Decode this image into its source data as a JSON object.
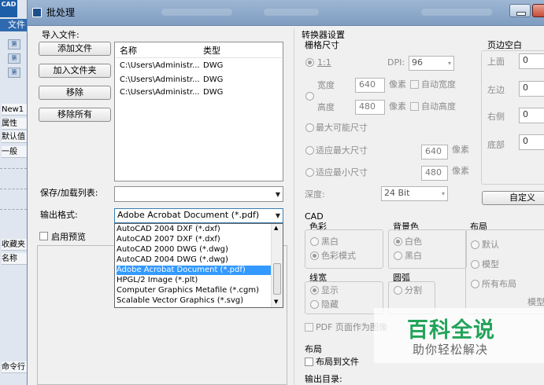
{
  "bg_app": {
    "logo": "CAD",
    "menu": "文件",
    "tool_labels": [
      "第",
      "第",
      "第"
    ],
    "tab": "New1",
    "panel_title": "属性",
    "default_label": "默认值",
    "tree_item": "一般",
    "fav_label": "收藏夹",
    "name_label": "名称",
    "cmd_label": "命令行"
  },
  "dialog": {
    "title": "批处理",
    "import_label": "导入文件:",
    "buttons": {
      "add_file": "添加文件",
      "add_folder": "加入文件夹",
      "remove": "移除",
      "remove_all": "移除所有",
      "custom": "自定义"
    },
    "file_list": {
      "columns": [
        "名称",
        "类型"
      ],
      "rows": [
        {
          "name": "C:\\Users\\Administr...",
          "type": "DWG"
        },
        {
          "name": "C:\\Users\\Administr...",
          "type": "DWG"
        },
        {
          "name": "C:\\Users\\Administr...",
          "type": "DWG"
        }
      ]
    },
    "save_list_label": "保存/加载列表:",
    "save_list_value": "",
    "output_format_label": "输出格式:",
    "output_format_value": "Adobe Acrobat Document (*.pdf)",
    "enable_preview_label": "启用预览",
    "format_options": [
      "AutoCAD 2004 DXF (*.dxf)",
      "AutoCAD 2007 DXF (*.dxf)",
      "AutoCAD 2000 DWG (*.dwg)",
      "AutoCAD 2004 DWG (*.dwg)",
      "Adobe Acrobat Document (*.pdf)",
      "HPGL/2 Image (*.plt)",
      "Computer Graphics Metafile (*.cgm)",
      "Scalable Vector Graphics (*.svg)"
    ],
    "selected_format_index": 4,
    "converter": {
      "title": "转换器设置",
      "raster_size": "栅格尺寸",
      "ratio": "1:1",
      "dpi_label": "DPI:",
      "dpi_value": "96",
      "width_label": "宽度",
      "width_value": "640",
      "height_label": "高度",
      "height_value": "480",
      "pixel_unit": "像素",
      "auto_width": "自动宽度",
      "auto_height": "自动高度",
      "max_possible": "最大可能尺寸",
      "fit_max": "适应最大尺寸",
      "fit_max_value": "640",
      "fit_min": "适应最小尺寸",
      "fit_min_value": "480",
      "depth_label": "深度:",
      "depth_value": "24 Bit"
    },
    "margins": {
      "title": "页边空白",
      "top": "上面",
      "left": "左边",
      "right": "右侧",
      "bottom": "底部",
      "top_value": "0",
      "left_value": "0",
      "right_value": "0",
      "bottom_value": "0"
    },
    "cad": {
      "title": "CAD",
      "color_title": "色彩",
      "bw": "黑白",
      "color_mode": "色彩模式",
      "bg_title": "背景色",
      "white": "白色",
      "black": "黑白",
      "layout_title": "布局",
      "layout_default": "默认",
      "layout_model": "模型",
      "layout_all": "所有布局",
      "layout_partial": "模型",
      "lw_title": "线宽",
      "lw_show": "显示",
      "lw_hide": "隐藏",
      "arc_title": "圆弧",
      "arc_split": "分割",
      "pdf_as_image": "PDF 页面作为图像"
    },
    "layout_section": {
      "title": "布局",
      "to_file": "布局到文件"
    },
    "output_dir_label": "输出目录:"
  },
  "watermark": {
    "title": "百科全说",
    "subtitle": "助你轻松解决"
  },
  "colors": {
    "titlebar": "#8aa7c9",
    "selection": "#3399ff",
    "watermark_green": "#23a35a"
  }
}
